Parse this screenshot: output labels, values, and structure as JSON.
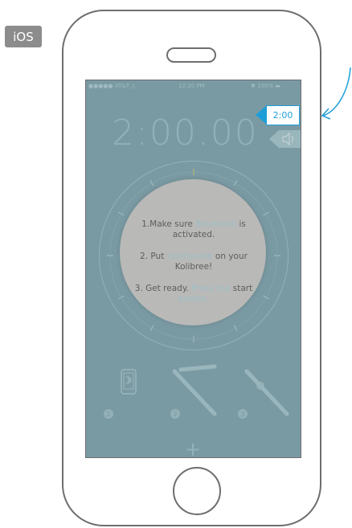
{
  "platform_badge": "iOS",
  "status_bar": {
    "carrier": "●●●●● AT&T △",
    "time": "12:20 PM",
    "battery": "✱ 100% ▬"
  },
  "timer": {
    "display": "2:00.00"
  },
  "duration_chip": {
    "label": "2:00"
  },
  "instructions": {
    "step1_prefix": "1.Make sure ",
    "step1_highlight": "Bluetooth",
    "step1_suffix": " is activated.",
    "step2_prefix": "2. Put ",
    "step2_highlight": "toothpaste",
    "step2_suffix": " on your Kolibree!",
    "step3_prefix": "3. Get ready. ",
    "step3_highlight": "Press the",
    "step3_suffix": " start ",
    "step3_highlight2": "button."
  },
  "steps": [
    {
      "number": "1",
      "icon": "phone-bluetooth-icon"
    },
    {
      "number": "2",
      "icon": "toothbrush-paste-icon"
    },
    {
      "number": "3",
      "icon": "toothbrush-power-icon"
    }
  ],
  "colors": {
    "screen_overlay": "#7a9aa3",
    "accent": "#1d9ed9",
    "highlight": "#9fbfc7",
    "dial_disc": "#b9b9b7"
  }
}
